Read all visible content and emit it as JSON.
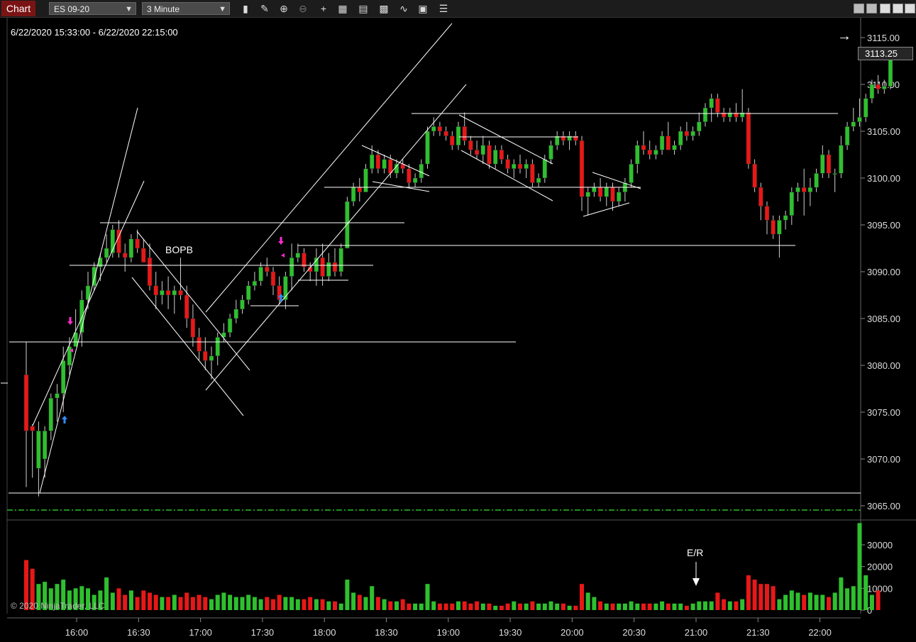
{
  "toolbar": {
    "tab_label": "Chart",
    "instrument": "ES 09-20",
    "interval": "3 Minute",
    "icons": [
      "bar-type-icon",
      "drawing-tools-icon",
      "zoom-in-icon",
      "zoom-out-icon",
      "crosshair-icon",
      "data-box-icon",
      "properties-icon",
      "strategies-icon",
      "indicators-icon",
      "templates-icon",
      "chart-trader-icon"
    ]
  },
  "header": {
    "date_range": "6/22/2020 15:33:00 - 6/22/2020 22:15:00",
    "copyright": "© 2020 NinjaTrader, LLC"
  },
  "annotations": {
    "bopb": "BOPB",
    "er": "E/R"
  },
  "colors": {
    "up": "#2ec02e",
    "down": "#e81818",
    "background": "#000000",
    "line": "#ffffff",
    "ref_line": "#1f8f1f"
  },
  "chart_data": {
    "type": "candlestick",
    "last_price": "3113.25",
    "price_axis": {
      "ticks": [
        "3115.00",
        "3110.00",
        "3105.00",
        "3100.00",
        "3095.00",
        "3090.00",
        "3085.00",
        "3080.00",
        "3075.00",
        "3070.00",
        "3065.00"
      ],
      "ylim": [
        3063.5,
        3116.5
      ]
    },
    "volume_axis": {
      "ticks": [
        "30000",
        "20000",
        "10000",
        "0"
      ],
      "ylim": [
        0,
        40000
      ]
    },
    "time_ticks": [
      "16:00",
      "16:30",
      "17:00",
      "17:30",
      "18:00",
      "18:30",
      "19:00",
      "19:30",
      "20:00",
      "20:30",
      "21:00",
      "21:30",
      "22:00"
    ],
    "candles": [
      [
        3079,
        3082.5,
        3067,
        3073
      ],
      [
        3073.5,
        3073.7,
        3068,
        3073
      ],
      [
        3069,
        3074,
        3066,
        3073
      ],
      [
        3070,
        3073.5,
        3068,
        3073
      ],
      [
        3073,
        3077,
        3072,
        3076.5
      ],
      [
        3076.5,
        3078,
        3074,
        3077
      ],
      [
        3077,
        3082,
        3075,
        3080.5
      ],
      [
        3080,
        3083,
        3079,
        3082
      ],
      [
        3082,
        3086,
        3082,
        3083.5
      ],
      [
        3083.5,
        3088,
        3082,
        3087
      ],
      [
        3087,
        3090,
        3086,
        3088.5
      ],
      [
        3088.5,
        3091,
        3088,
        3090.5
      ],
      [
        3090.5,
        3092,
        3089,
        3091.5
      ],
      [
        3091.5,
        3094,
        3091,
        3092.5
      ],
      [
        3092,
        3095,
        3091.5,
        3094.5
      ],
      [
        3094.5,
        3095.5,
        3091.5,
        3092
      ],
      [
        3092,
        3093,
        3090,
        3091.5
      ],
      [
        3091.5,
        3094,
        3091,
        3093.5
      ],
      [
        3093.5,
        3094.5,
        3092,
        3092.5
      ],
      [
        3092.5,
        3093.5,
        3091.5,
        3091
      ],
      [
        3091.5,
        3093,
        3088,
        3088.5
      ],
      [
        3088.5,
        3090,
        3086,
        3087.5
      ],
      [
        3087.5,
        3089,
        3086.5,
        3088
      ],
      [
        3088,
        3089.5,
        3086,
        3087.5
      ],
      [
        3087.5,
        3088.5,
        3085.5,
        3088
      ],
      [
        3088,
        3091.5,
        3087,
        3087.5
      ],
      [
        3087.5,
        3088.5,
        3084,
        3085
      ],
      [
        3085,
        3086.5,
        3082,
        3083
      ],
      [
        3083,
        3084,
        3080.5,
        3081.5
      ],
      [
        3081.5,
        3083,
        3079.5,
        3080.5
      ],
      [
        3080.5,
        3082,
        3078.5,
        3081
      ],
      [
        3081,
        3083.5,
        3080,
        3083
      ],
      [
        3083,
        3084.5,
        3082.5,
        3083.5
      ],
      [
        3083.5,
        3085.5,
        3083,
        3085
      ],
      [
        3085,
        3087,
        3084.5,
        3086
      ],
      [
        3086,
        3087.5,
        3085.5,
        3087
      ],
      [
        3087,
        3089,
        3086.5,
        3088.5
      ],
      [
        3088.5,
        3090,
        3088,
        3089
      ],
      [
        3089,
        3091,
        3088.5,
        3090.5
      ],
      [
        3090.5,
        3091.5,
        3089.5,
        3090
      ],
      [
        3090,
        3090.5,
        3087.5,
        3088.5
      ],
      [
        3088.5,
        3089.5,
        3086.5,
        3087
      ],
      [
        3087,
        3090,
        3086,
        3089.5
      ],
      [
        3089.5,
        3093,
        3088,
        3091.5
      ],
      [
        3091.5,
        3093,
        3091,
        3092
      ],
      [
        3092,
        3092.5,
        3090,
        3090.5
      ],
      [
        3090.5,
        3091,
        3089,
        3090
      ],
      [
        3090,
        3092.5,
        3088.5,
        3091.5
      ],
      [
        3091.5,
        3093,
        3088.5,
        3089.5
      ],
      [
        3089.5,
        3092,
        3089,
        3091
      ],
      [
        3091,
        3092.5,
        3089.5,
        3090
      ],
      [
        3090,
        3093,
        3089.5,
        3092.5
      ],
      [
        3092.5,
        3098,
        3092.5,
        3097.5
      ],
      [
        3097.5,
        3099.5,
        3097,
        3099
      ],
      [
        3099,
        3100,
        3097.5,
        3098.5
      ],
      [
        3098.5,
        3101.5,
        3098.5,
        3101
      ],
      [
        3101,
        3103.5,
        3100.5,
        3102.5
      ],
      [
        3102.5,
        3103,
        3100.5,
        3101
      ],
      [
        3101,
        3102.5,
        3100.5,
        3102
      ],
      [
        3102,
        3102.5,
        3100,
        3100.5
      ],
      [
        3100.5,
        3102,
        3100,
        3101.5
      ],
      [
        3101.5,
        3102,
        3100.5,
        3101
      ],
      [
        3101,
        3101.5,
        3099,
        3099.5
      ],
      [
        3099.5,
        3100.5,
        3099,
        3100
      ],
      [
        3100,
        3102,
        3099.5,
        3101.5
      ],
      [
        3101.5,
        3105.5,
        3101,
        3105
      ],
      [
        3105,
        3106.5,
        3104.5,
        3105.5
      ],
      [
        3105.5,
        3106,
        3104.5,
        3105
      ],
      [
        3105,
        3105.5,
        3104,
        3104.5
      ],
      [
        3104.5,
        3105,
        3103,
        3103.5
      ],
      [
        3103.5,
        3106,
        3103,
        3105.5
      ],
      [
        3105.5,
        3107,
        3103.5,
        3104
      ],
      [
        3104,
        3104.5,
        3102.5,
        3103
      ],
      [
        3103,
        3104,
        3102,
        3102.5
      ],
      [
        3102.5,
        3104.5,
        3101.5,
        3103.5
      ],
      [
        3103.5,
        3104,
        3101,
        3101.5
      ],
      [
        3101.5,
        3103.5,
        3101,
        3103
      ],
      [
        3103,
        3103.5,
        3101.5,
        3102
      ],
      [
        3102,
        3102.5,
        3100.5,
        3101
      ],
      [
        3101,
        3102,
        3100,
        3101.5
      ],
      [
        3101.5,
        3102.5,
        3100.5,
        3101
      ],
      [
        3101,
        3102,
        3100,
        3101.5
      ],
      [
        3101.5,
        3102,
        3099,
        3099.5
      ],
      [
        3099.5,
        3100.5,
        3099,
        3100
      ],
      [
        3100,
        3102.5,
        3099.5,
        3102
      ],
      [
        3102,
        3104,
        3101.5,
        3103.5
      ],
      [
        3103.5,
        3105,
        3103,
        3104.5
      ],
      [
        3104.5,
        3105,
        3103.5,
        3104
      ],
      [
        3104,
        3105,
        3103,
        3104.5
      ],
      [
        3104.5,
        3105,
        3103.5,
        3104
      ],
      [
        3104,
        3104.5,
        3096.5,
        3098
      ],
      [
        3098,
        3099,
        3096,
        3098.5
      ],
      [
        3098.5,
        3099.5,
        3098,
        3099
      ],
      [
        3099,
        3100,
        3097.5,
        3098
      ],
      [
        3098,
        3099.5,
        3097,
        3099
      ],
      [
        3099,
        3099.5,
        3096.5,
        3097.5
      ],
      [
        3097.5,
        3099,
        3097,
        3098.5
      ],
      [
        3098.5,
        3100,
        3097.5,
        3099.5
      ],
      [
        3099.5,
        3102,
        3099,
        3101.5
      ],
      [
        3101.5,
        3104,
        3100.5,
        3103.5
      ],
      [
        3103.5,
        3105,
        3102.5,
        3103
      ],
      [
        3103,
        3104,
        3102,
        3102.5
      ],
      [
        3102.5,
        3103.5,
        3102,
        3103
      ],
      [
        3103,
        3105,
        3102.5,
        3104.5
      ],
      [
        3104.5,
        3106,
        3103,
        3103
      ],
      [
        3103,
        3104,
        3102.5,
        3103.5
      ],
      [
        3103.5,
        3105.5,
        3103,
        3105
      ],
      [
        3105,
        3106,
        3104,
        3104.5
      ],
      [
        3104.5,
        3105.5,
        3104,
        3105
      ],
      [
        3105,
        3107,
        3104.5,
        3106
      ],
      [
        3106,
        3108,
        3105.5,
        3107.5
      ],
      [
        3107.5,
        3109,
        3106,
        3108.5
      ],
      [
        3108.5,
        3109,
        3106.5,
        3107
      ],
      [
        3107,
        3107.5,
        3106,
        3106.5
      ],
      [
        3106.5,
        3107.5,
        3106,
        3107
      ],
      [
        3107,
        3108,
        3106,
        3106.5
      ],
      [
        3106.5,
        3109.5,
        3106,
        3107
      ],
      [
        3107,
        3107.5,
        3101,
        3101.5
      ],
      [
        3101.5,
        3102,
        3098.5,
        3099
      ],
      [
        3099,
        3099.5,
        3095.5,
        3097
      ],
      [
        3097,
        3097.5,
        3094,
        3095.5
      ],
      [
        3095.5,
        3096,
        3093.5,
        3094
      ],
      [
        3094,
        3096,
        3091.5,
        3095.5
      ],
      [
        3095.5,
        3096.5,
        3094.5,
        3096
      ],
      [
        3096,
        3099,
        3095,
        3098.5
      ],
      [
        3098.5,
        3099.5,
        3097.5,
        3099
      ],
      [
        3099,
        3101,
        3096,
        3098.5
      ],
      [
        3098.5,
        3100,
        3097,
        3099
      ],
      [
        3099,
        3101,
        3098.5,
        3100.5
      ],
      [
        3100.5,
        3103.5,
        3100,
        3102.5
      ],
      [
        3102.5,
        3103,
        3100,
        3100.5
      ],
      [
        3100.5,
        3101,
        3098.5,
        3100.5
      ],
      [
        3100.5,
        3104.5,
        3100,
        3103.5
      ],
      [
        3103.5,
        3106,
        3103,
        3105.5
      ],
      [
        3105.5,
        3107.5,
        3105,
        3106
      ],
      [
        3106,
        3108.5,
        3105.5,
        3106.5
      ],
      [
        3106.5,
        3109,
        3106,
        3108.5
      ],
      [
        3108.5,
        3110.5,
        3108,
        3110
      ],
      [
        3110,
        3111,
        3109,
        3109.5
      ],
      [
        3109.5,
        3110.5,
        3109,
        3109.8
      ],
      [
        3109.8,
        3114,
        3109.5,
        3113.25
      ]
    ],
    "volume": [
      23000,
      19000,
      12000,
      13000,
      10000,
      12000,
      14000,
      9000,
      10000,
      11000,
      10000,
      7000,
      9000,
      15000,
      8000,
      10000,
      7000,
      9000,
      6000,
      9000,
      8000,
      7000,
      6000,
      6000,
      7000,
      6000,
      8000,
      6000,
      7000,
      6000,
      5000,
      7000,
      8000,
      7000,
      6000,
      6000,
      7000,
      6000,
      5000,
      6000,
      5000,
      7000,
      6000,
      6000,
      5000,
      5000,
      6000,
      5000,
      5000,
      4000,
      4000,
      3000,
      14000,
      8000,
      7000,
      6000,
      11000,
      6000,
      5000,
      4000,
      4000,
      5000,
      3000,
      3000,
      3000,
      12000,
      4000,
      3000,
      3000,
      3000,
      4000,
      4000,
      3000,
      4000,
      3000,
      3000,
      2000,
      2000,
      3000,
      4000,
      3000,
      3000,
      4000,
      3000,
      3000,
      4000,
      3000,
      3000,
      2000,
      2000,
      12000,
      8000,
      6000,
      4000,
      3000,
      3000,
      3000,
      3000,
      4000,
      3000,
      3000,
      3000,
      3000,
      4000,
      3000,
      3000,
      3000,
      2000,
      3000,
      4000,
      4000,
      4000,
      8000,
      5000,
      4000,
      4000,
      5000,
      16000,
      14000,
      12000,
      12000,
      11000,
      5000,
      7000,
      9000,
      8000,
      7000,
      8000,
      7000,
      7000,
      6000,
      8000,
      15000,
      10000,
      11000,
      40000,
      16000,
      7000,
      9000
    ]
  }
}
